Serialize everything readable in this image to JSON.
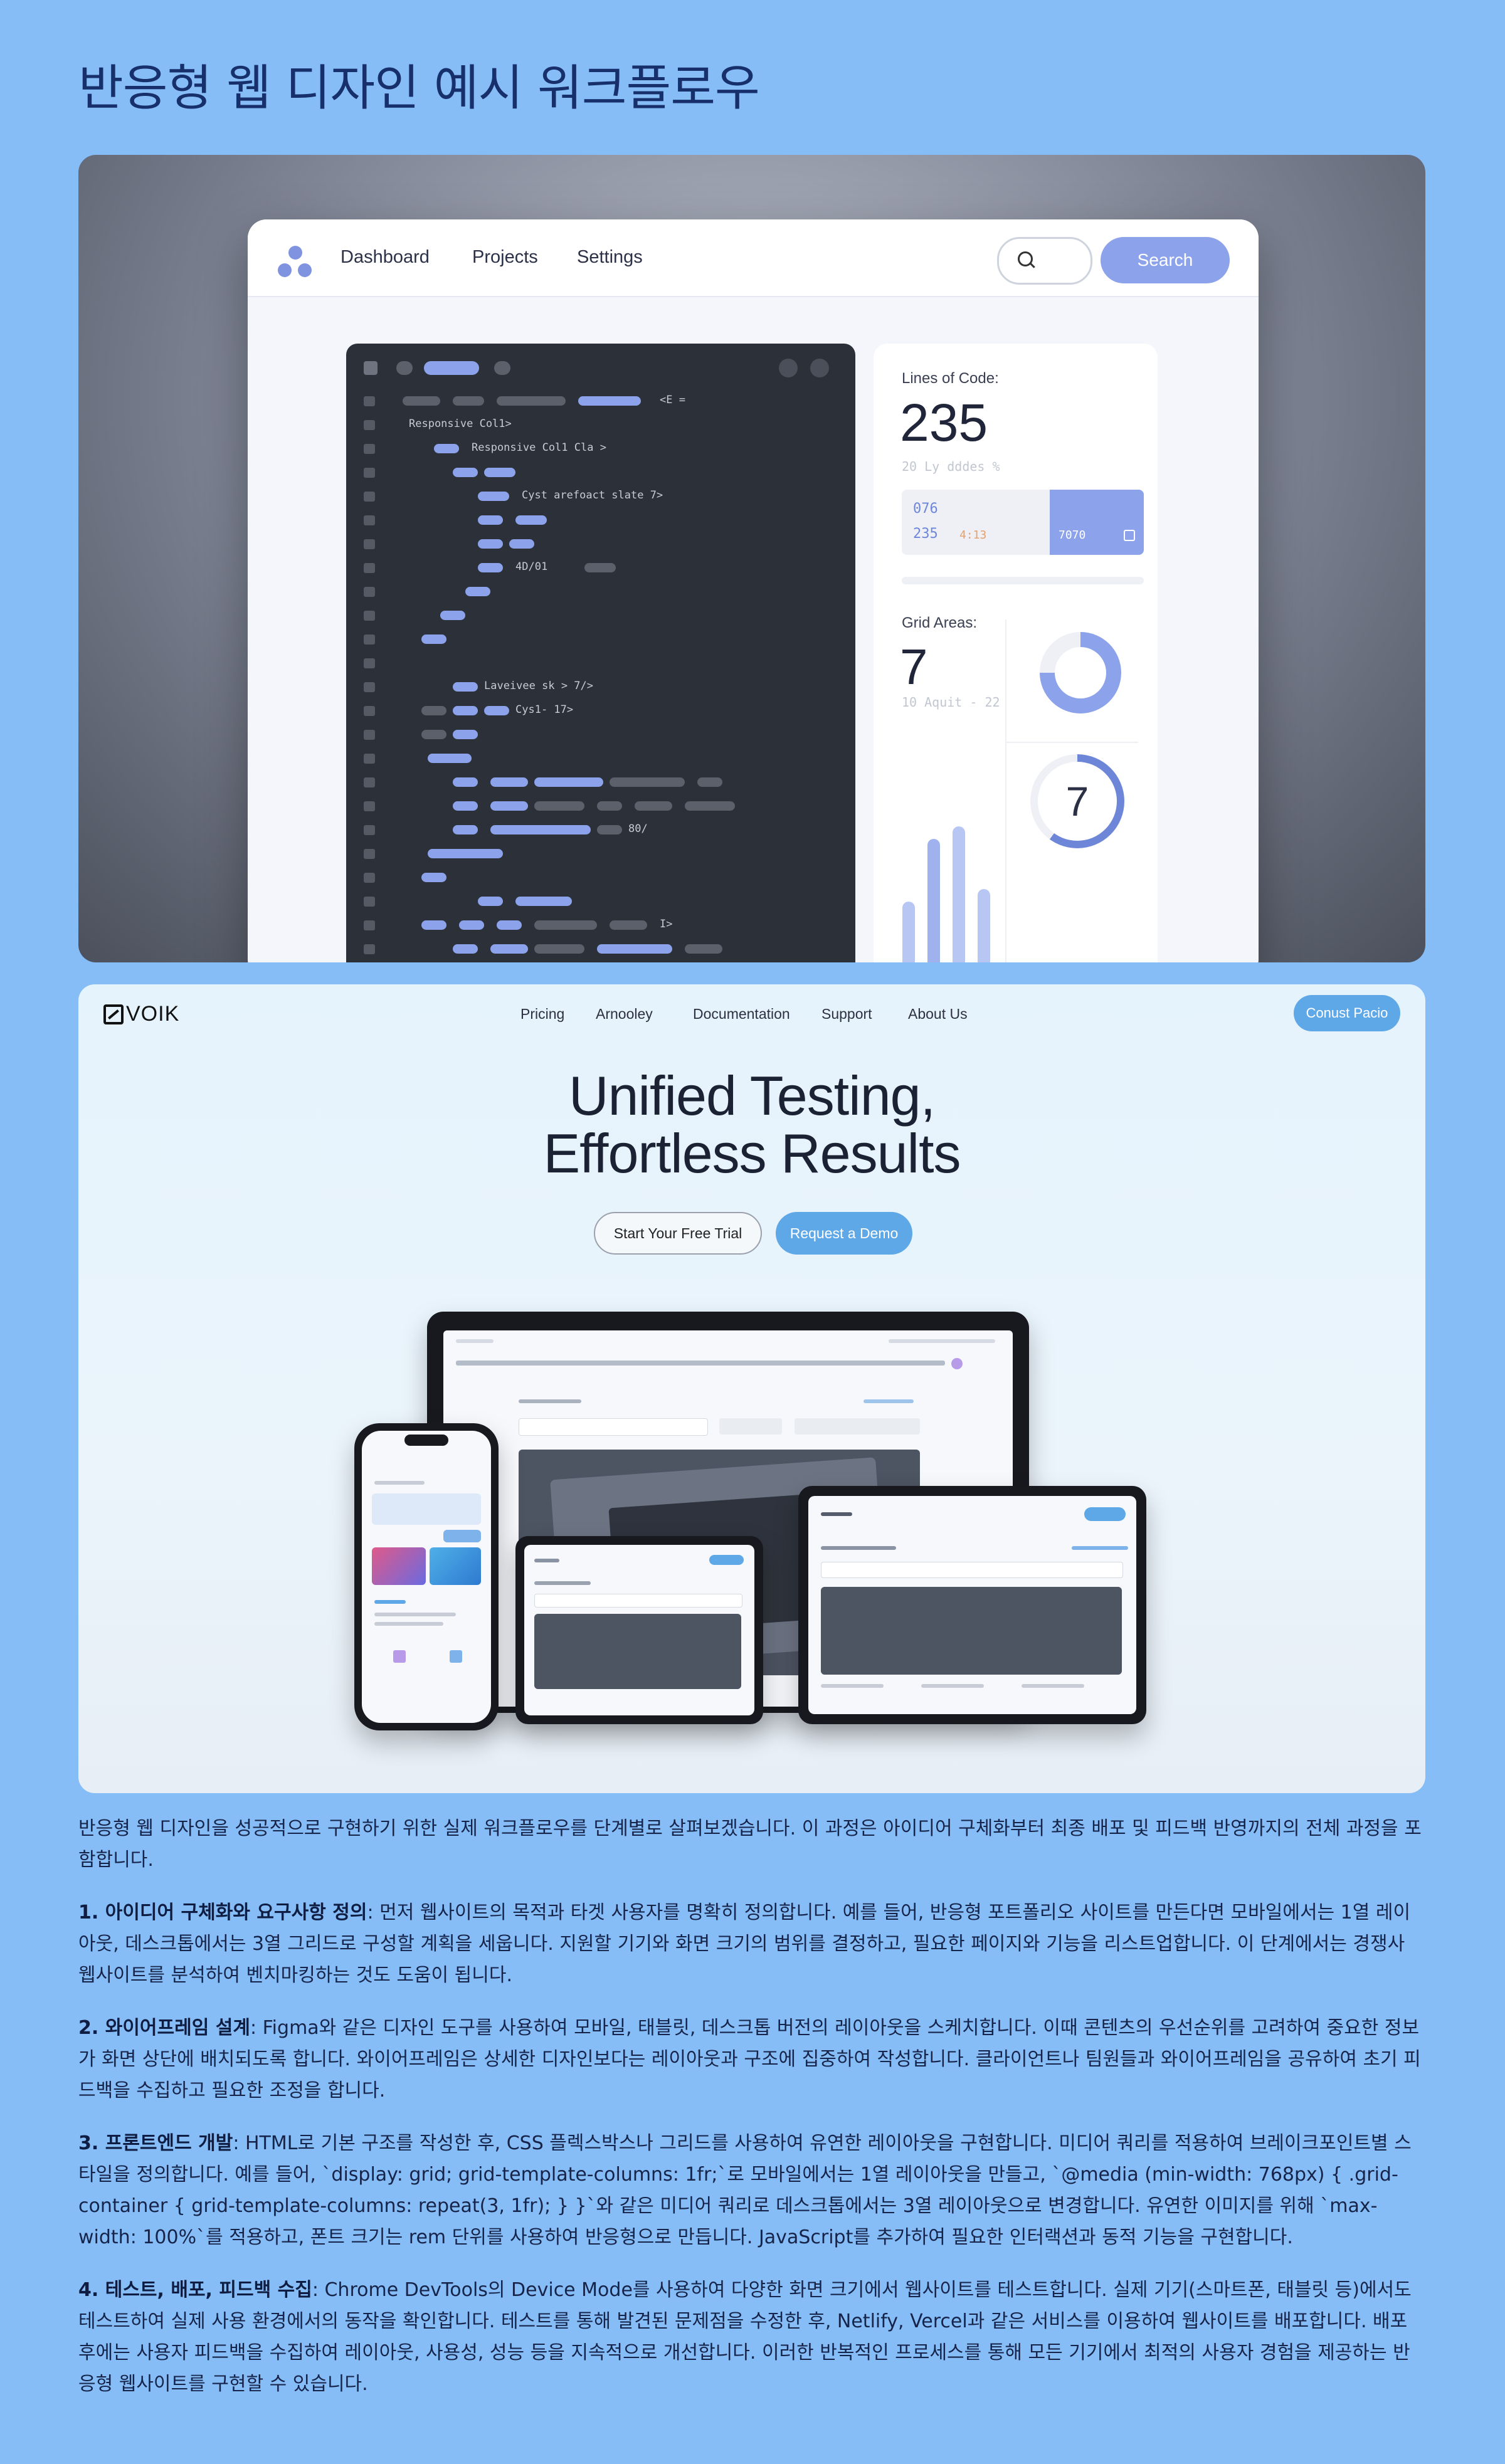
{
  "page": {
    "title": "반응형 웹 디자인 예시 워크플로우"
  },
  "panel1": {
    "nav": {
      "links": [
        "Dashboard",
        "Projects",
        "Settings"
      ],
      "search_button": "Search"
    },
    "code_snippets": [
      "<E =",
      "Responsive Col1>",
      "Responsive Col1 Cla >",
      "Cyst arefoact slate 7>",
      "4D/01",
      "Laveivee sk > 7/>",
      "Cys1- 17>",
      "80/",
      "I>"
    ],
    "stats": {
      "loc_label": "Lines of Code:",
      "loc_value": "235",
      "loc_sub": "20 Ly dddes %",
      "box_numbers": [
        "076",
        "235",
        "4:13",
        "7070"
      ],
      "grid_label": "Grid Areas:",
      "grid_value": "7",
      "grid_sub": "10 Aquit - 22",
      "ring_value": "7"
    }
  },
  "panel2": {
    "brand": "VOIK",
    "nav_links": [
      "Pricing",
      "Arnooley",
      "Documentation",
      "Support",
      "About Us"
    ],
    "cta": "Conust Pacio",
    "hero_line1": "Unified Testing,",
    "hero_line2": "Effortless Results",
    "btn_trial": "Start Your Free Trial",
    "btn_demo": "Request a Demo"
  },
  "article": {
    "intro": "반응형 웹 디자인을 성공적으로 구현하기 위한 실제 워크플로우를 단계별로 살펴보겠습니다. 이 과정은 아이디어 구체화부터 최종 배포 및 피드백 반영까지의 전체 과정을 포함합니다.",
    "steps": [
      {
        "title": "1. 아이디어 구체화와 요구사항 정의",
        "body": ": 먼저 웹사이트의 목적과 타겟 사용자를 명확히 정의합니다. 예를 들어, 반응형 포트폴리오 사이트를 만든다면 모바일에서는 1열 레이아웃, 데스크톱에서는 3열 그리드로 구성할 계획을 세웁니다. 지원할 기기와 화면 크기의 범위를 결정하고, 필요한 페이지와 기능을 리스트업합니다. 이 단계에서는 경쟁사 웹사이트를 분석하여 벤치마킹하는 것도 도움이 됩니다."
      },
      {
        "title": "2. 와이어프레임 설계",
        "body": ": Figma와 같은 디자인 도구를 사용하여 모바일, 태블릿, 데스크톱 버전의 레이아웃을 스케치합니다. 이때 콘텐츠의 우선순위를 고려하여 중요한 정보가 화면 상단에 배치되도록 합니다. 와이어프레임은 상세한 디자인보다는 레이아웃과 구조에 집중하여 작성합니다. 클라이언트나 팀원들과 와이어프레임을 공유하여 초기 피드백을 수집하고 필요한 조정을 합니다."
      },
      {
        "title": "3. 프론트엔드 개발",
        "body": ": HTML로 기본 구조를 작성한 후, CSS 플렉스박스나 그리드를 사용하여 유연한 레이아웃을 구현합니다. 미디어 쿼리를 적용하여 브레이크포인트별 스타일을 정의합니다. 예를 들어, `display: grid; grid-template-columns: 1fr;`로 모바일에서는 1열 레이아웃을 만들고, `@media (min-width: 768px) { .grid-container { grid-template-columns: repeat(3, 1fr); } }`와 같은 미디어 쿼리로 데스크톱에서는 3열 레이아웃으로 변경합니다. 유연한 이미지를 위해 `max-width: 100%`를 적용하고, 폰트 크기는 rem 단위를 사용하여 반응형으로 만듭니다. JavaScript를 추가하여 필요한 인터랙션과 동적 기능을 구현합니다."
      },
      {
        "title": "4. 테스트, 배포, 피드백 수집",
        "body": ": Chrome DevTools의 Device Mode를 사용하여 다양한 화면 크기에서 웹사이트를 테스트합니다. 실제 기기(스마트폰, 태블릿 등)에서도 테스트하여 실제 사용 환경에서의 동작을 확인합니다. 테스트를 통해 발견된 문제점을 수정한 후, Netlify, Vercel과 같은 서비스를 이용하여 웹사이트를 배포합니다. 배포 후에는 사용자 피드백을 수집하여 레이아웃, 사용성, 성능 등을 지속적으로 개선합니다. 이러한 반복적인 프로세스를 통해 모든 기기에서 최적의 사용자 경험을 제공하는 반응형 웹사이트를 구현할 수 있습니다."
      }
    ]
  }
}
